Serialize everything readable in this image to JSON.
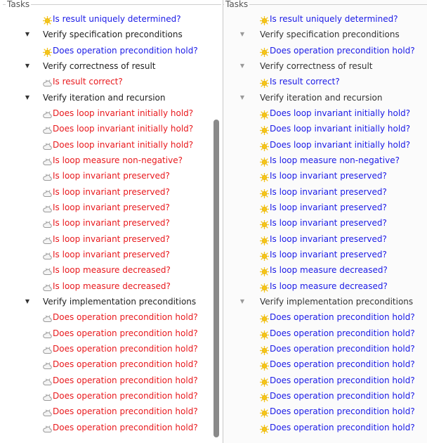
{
  "left_panel": {
    "title": "Tasks",
    "rows": [
      {
        "kind": "task",
        "icon": "sun-icon",
        "status": "ok",
        "label": "Is result uniquely determined?"
      },
      {
        "kind": "category",
        "label": "Verify specification preconditions"
      },
      {
        "kind": "task",
        "icon": "sun-icon",
        "status": "ok",
        "label": "Does operation precondition hold?"
      },
      {
        "kind": "category",
        "label": "Verify correctness of result"
      },
      {
        "kind": "task",
        "icon": "cloud-icon",
        "status": "fail",
        "label": "Is result correct?"
      },
      {
        "kind": "category",
        "label": "Verify iteration and recursion"
      },
      {
        "kind": "task",
        "icon": "cloud-icon",
        "status": "fail",
        "label": "Does loop invariant initially hold?"
      },
      {
        "kind": "task",
        "icon": "cloud-icon",
        "status": "fail",
        "label": "Does loop invariant initially hold?"
      },
      {
        "kind": "task",
        "icon": "cloud-icon",
        "status": "fail",
        "label": "Does loop invariant initially hold?"
      },
      {
        "kind": "task",
        "icon": "cloud-icon",
        "status": "fail",
        "label": "Is loop measure non-negative?"
      },
      {
        "kind": "task",
        "icon": "cloud-icon",
        "status": "fail",
        "label": "Is loop invariant preserved?"
      },
      {
        "kind": "task",
        "icon": "cloud-icon",
        "status": "fail",
        "label": "Is loop invariant preserved?"
      },
      {
        "kind": "task",
        "icon": "cloud-icon",
        "status": "fail",
        "label": "Is loop invariant preserved?"
      },
      {
        "kind": "task",
        "icon": "cloud-icon",
        "status": "fail",
        "label": "Is loop invariant preserved?"
      },
      {
        "kind": "task",
        "icon": "cloud-icon",
        "status": "fail",
        "label": "Is loop invariant preserved?"
      },
      {
        "kind": "task",
        "icon": "cloud-icon",
        "status": "fail",
        "label": "Is loop invariant preserved?"
      },
      {
        "kind": "task",
        "icon": "cloud-icon",
        "status": "fail",
        "label": "Is loop measure decreased?"
      },
      {
        "kind": "task",
        "icon": "cloud-icon",
        "status": "fail",
        "label": "Is loop measure decreased?"
      },
      {
        "kind": "category",
        "label": "Verify implementation preconditions"
      },
      {
        "kind": "task",
        "icon": "cloud-icon",
        "status": "fail",
        "label": "Does operation precondition hold?"
      },
      {
        "kind": "task",
        "icon": "cloud-icon",
        "status": "fail",
        "label": "Does operation precondition hold?"
      },
      {
        "kind": "task",
        "icon": "cloud-icon",
        "status": "fail",
        "label": "Does operation precondition hold?"
      },
      {
        "kind": "task",
        "icon": "cloud-icon",
        "status": "fail",
        "label": "Does operation precondition hold?"
      },
      {
        "kind": "task",
        "icon": "cloud-icon",
        "status": "fail",
        "label": "Does operation precondition hold?"
      },
      {
        "kind": "task",
        "icon": "cloud-icon",
        "status": "fail",
        "label": "Does operation precondition hold?"
      },
      {
        "kind": "task",
        "icon": "cloud-icon",
        "status": "fail",
        "label": "Does operation precondition hold?"
      },
      {
        "kind": "task",
        "icon": "cloud-icon",
        "status": "fail",
        "label": "Does operation precondition hold?"
      }
    ]
  },
  "right_panel": {
    "title": "Tasks",
    "rows": [
      {
        "kind": "task",
        "icon": "sun-icon",
        "status": "ok",
        "label": "Is result uniquely determined?"
      },
      {
        "kind": "category",
        "label": "Verify specification preconditions"
      },
      {
        "kind": "task",
        "icon": "sun-icon",
        "status": "ok",
        "label": "Does operation precondition hold?"
      },
      {
        "kind": "category",
        "label": "Verify correctness of result"
      },
      {
        "kind": "task",
        "icon": "sun-icon",
        "status": "ok",
        "label": "Is result correct?"
      },
      {
        "kind": "category",
        "label": "Verify iteration and recursion"
      },
      {
        "kind": "task",
        "icon": "sun-icon",
        "status": "ok",
        "label": "Does loop invariant initially hold?"
      },
      {
        "kind": "task",
        "icon": "sun-icon",
        "status": "ok",
        "label": "Does loop invariant initially hold?"
      },
      {
        "kind": "task",
        "icon": "sun-icon",
        "status": "ok",
        "label": "Does loop invariant initially hold?"
      },
      {
        "kind": "task",
        "icon": "sun-icon",
        "status": "ok",
        "label": "Is loop measure non-negative?"
      },
      {
        "kind": "task",
        "icon": "sun-icon",
        "status": "ok",
        "label": "Is loop invariant preserved?"
      },
      {
        "kind": "task",
        "icon": "sun-icon",
        "status": "ok",
        "label": "Is loop invariant preserved?"
      },
      {
        "kind": "task",
        "icon": "sun-icon",
        "status": "ok",
        "label": "Is loop invariant preserved?"
      },
      {
        "kind": "task",
        "icon": "sun-icon",
        "status": "ok",
        "label": "Is loop invariant preserved?"
      },
      {
        "kind": "task",
        "icon": "sun-icon",
        "status": "ok",
        "label": "Is loop invariant preserved?"
      },
      {
        "kind": "task",
        "icon": "sun-icon",
        "status": "ok",
        "label": "Is loop invariant preserved?"
      },
      {
        "kind": "task",
        "icon": "sun-icon",
        "status": "ok",
        "label": "Is loop measure decreased?"
      },
      {
        "kind": "task",
        "icon": "sun-icon",
        "status": "ok",
        "label": "Is loop measure decreased?"
      },
      {
        "kind": "category",
        "label": "Verify implementation preconditions"
      },
      {
        "kind": "task",
        "icon": "sun-icon",
        "status": "ok",
        "label": "Does operation precondition hold?"
      },
      {
        "kind": "task",
        "icon": "sun-icon",
        "status": "ok",
        "label": "Does operation precondition hold?"
      },
      {
        "kind": "task",
        "icon": "sun-icon",
        "status": "ok",
        "label": "Does operation precondition hold?"
      },
      {
        "kind": "task",
        "icon": "sun-icon",
        "status": "ok",
        "label": "Does operation precondition hold?"
      },
      {
        "kind": "task",
        "icon": "sun-icon",
        "status": "ok",
        "label": "Does operation precondition hold?"
      },
      {
        "kind": "task",
        "icon": "sun-icon",
        "status": "ok",
        "label": "Does operation precondition hold?"
      },
      {
        "kind": "task",
        "icon": "sun-icon",
        "status": "ok",
        "label": "Does operation precondition hold?"
      },
      {
        "kind": "task",
        "icon": "sun-icon",
        "status": "ok",
        "label": "Does operation precondition hold?"
      }
    ]
  },
  "colors": {
    "fail_text": "#e8191d",
    "ok_text": "#1a1ae6",
    "sun_icon": "#f5c518",
    "cloud_icon": "#9a9a9a"
  }
}
